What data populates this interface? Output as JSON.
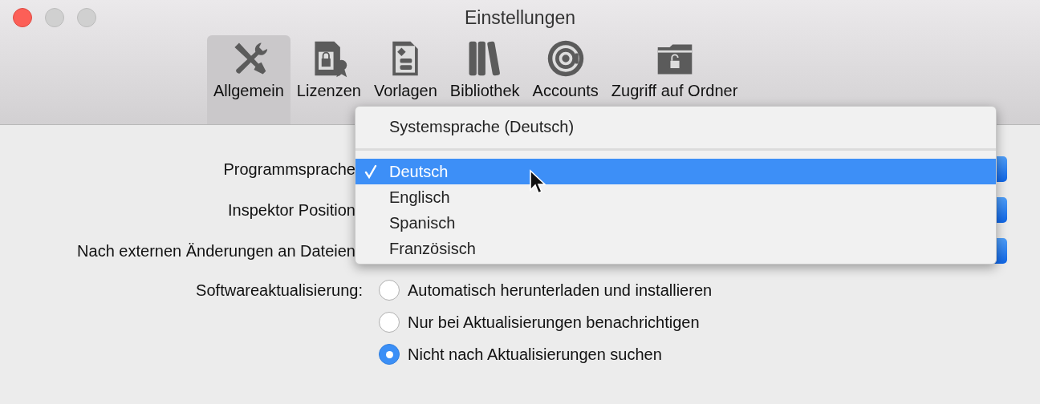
{
  "window": {
    "title": "Einstellungen"
  },
  "toolbar": {
    "tabs": [
      {
        "label": "Allgemein",
        "selected": true
      },
      {
        "label": "Lizenzen",
        "selected": false
      },
      {
        "label": "Vorlagen",
        "selected": false
      },
      {
        "label": "Bibliothek",
        "selected": false
      },
      {
        "label": "Accounts",
        "selected": false
      },
      {
        "label": "Zugriff auf Ordner",
        "selected": false
      }
    ]
  },
  "settings": [
    {
      "label": "Programmsprache"
    },
    {
      "label": "Inspektor Position"
    },
    {
      "label": "Nach externen Änderungen an Dateien"
    }
  ],
  "software_update": {
    "label": "Softwareaktualisierung:",
    "options": [
      {
        "label": "Automatisch herunterladen und installieren",
        "selected": false
      },
      {
        "label": "Nur bei Aktualisierungen benachrichtigen",
        "selected": false
      },
      {
        "label": "Nicht nach Aktualisierungen suchen",
        "selected": true
      }
    ]
  },
  "language_menu": {
    "items": [
      {
        "kind": "option",
        "label": "Systemsprache (Deutsch)",
        "checked": false,
        "selected": false
      },
      {
        "kind": "separator"
      },
      {
        "kind": "option",
        "label": "Deutsch",
        "checked": true,
        "selected": true
      },
      {
        "kind": "option",
        "label": "Englisch",
        "checked": false,
        "selected": false
      },
      {
        "kind": "option",
        "label": "Spanisch",
        "checked": false,
        "selected": false
      },
      {
        "kind": "option",
        "label": "Französisch",
        "checked": false,
        "selected": false
      }
    ]
  }
}
